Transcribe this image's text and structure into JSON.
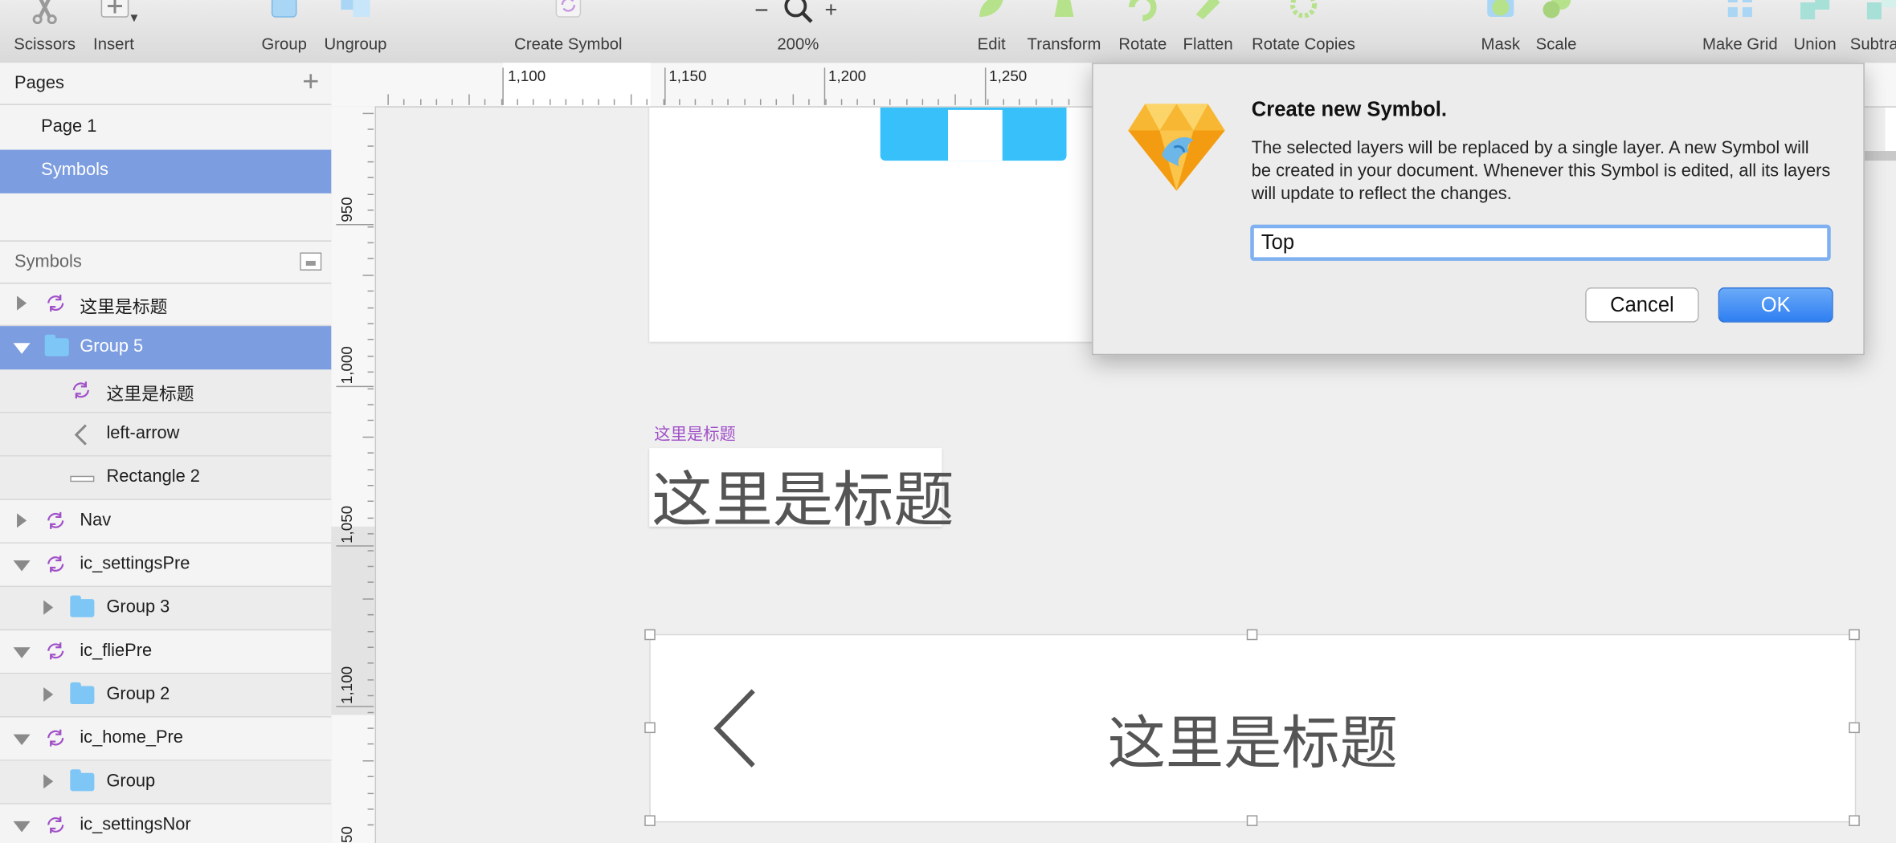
{
  "toolbar": {
    "scissors": "Scissors",
    "insert": "Insert",
    "group": "Group",
    "ungroup": "Ungroup",
    "create_symbol": "Create Symbol",
    "zoom": "200%",
    "zoom_minus": "−",
    "zoom_plus": "+",
    "edit": "Edit",
    "transform": "Transform",
    "rotate": "Rotate",
    "flatten": "Flatten",
    "rotate_copies": "Rotate Copies",
    "mask": "Mask",
    "scale": "Scale",
    "make_grid": "Make Grid",
    "union": "Union",
    "subtract": "Subtra"
  },
  "pages": {
    "header": "Pages",
    "add": "+",
    "items": [
      {
        "label": "Page 1"
      },
      {
        "label": "Symbols"
      }
    ]
  },
  "layers": {
    "header": "Symbols",
    "items": [
      {
        "label": "这里是标题"
      },
      {
        "label": "Group 5"
      },
      {
        "label": "这里是标题"
      },
      {
        "label": "left-arrow"
      },
      {
        "label": "Rectangle 2"
      },
      {
        "label": "Nav"
      },
      {
        "label": "ic_settingsPre"
      },
      {
        "label": "Group 3"
      },
      {
        "label": "ic_fliePre"
      },
      {
        "label": "Group 2"
      },
      {
        "label": "ic_home_Pre"
      },
      {
        "label": "Group"
      },
      {
        "label": "ic_settingsNor"
      }
    ]
  },
  "ruler": {
    "top": [
      "1,100",
      "1,150",
      "1,200",
      "1,250"
    ],
    "left": [
      "950",
      "1,000",
      "1,050",
      "1,100",
      "50"
    ]
  },
  "canvas": {
    "small_title": "这里是标题",
    "big_title": "这里是标题",
    "nav_title": "这里是标题",
    "nav_back": "‹"
  },
  "dialog": {
    "title": "Create new Symbol.",
    "message": "The selected layers will be replaced by a single layer. A new Symbol will be created in your document. Whenever this Symbol is edited, all its layers will update to reflect the changes.",
    "input_value": "Top",
    "cancel": "Cancel",
    "ok": "OK"
  },
  "colors": {
    "selection": "#7c9de0",
    "symbol_icon": "#a050c8",
    "folder": "#7ec6f5",
    "ok_button": "#2f7ff2",
    "artboard_blue": "#38c0fb"
  }
}
